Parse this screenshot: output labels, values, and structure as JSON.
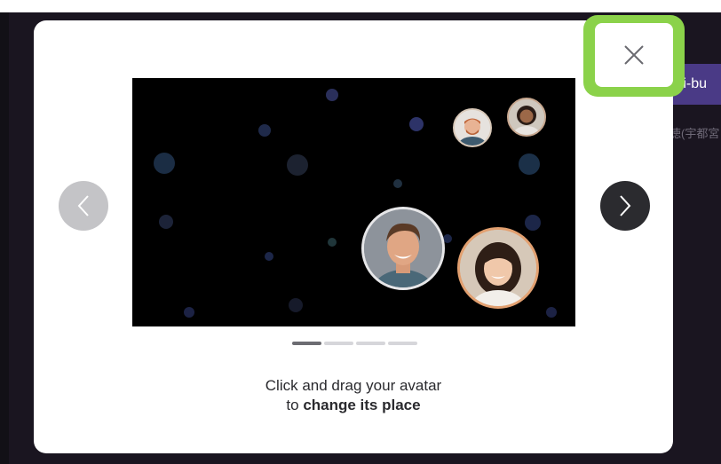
{
  "background": {
    "tag_label": "ri-bu",
    "japanese_text": "徳(宇都宮"
  },
  "modal": {
    "close_icon": "close-icon",
    "prev_icon": "chevron-left-icon",
    "next_icon": "chevron-right-icon",
    "pager": {
      "total": 4,
      "active_index": 0
    },
    "caption": {
      "line1": "Click and drag your avatar",
      "line2_prefix": "to ",
      "line2_bold": "change its place"
    }
  },
  "colors": {
    "highlight": "#8bd24a",
    "preview_bg": "#000000",
    "next_button": "#2b2b2f",
    "prev_button": "#c4c4c7",
    "bg_pill": "#4a3a86"
  }
}
